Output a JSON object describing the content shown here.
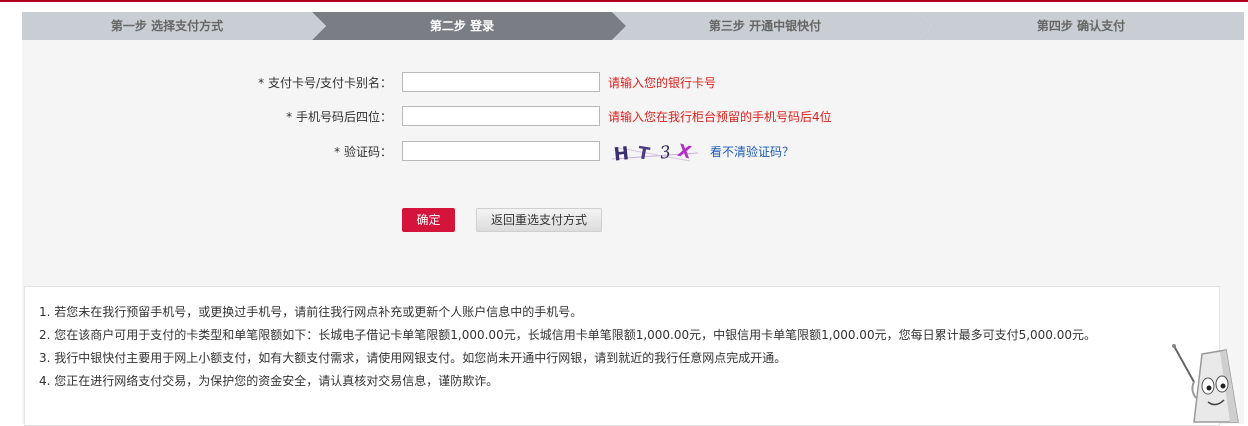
{
  "steps": [
    {
      "label": "第一步  选择支付方式",
      "active": false
    },
    {
      "label": "第二步  登录",
      "active": true
    },
    {
      "label": "第三步  开通中银快付",
      "active": false
    },
    {
      "label": "第四步  确认支付",
      "active": false
    }
  ],
  "form": {
    "card": {
      "label": "*  支付卡号/支付卡别名：",
      "value": "",
      "hint": "请输入您的银行卡号"
    },
    "phone": {
      "label": "*  手机号码后四位：",
      "value": "",
      "hint": "请输入您在我行柜台预留的手机号码后4位"
    },
    "captcha": {
      "label": "*  验证码：",
      "value": "",
      "image_text": "HT3X",
      "refresh_label": "看不清验证码？"
    }
  },
  "buttons": {
    "confirm": "确定",
    "back": "返回重选支付方式"
  },
  "notes": [
    "1. 若您未在我行预留手机号，或更换过手机号，请前往我行网点补充或更新个人账户信息中的手机号。",
    "2. 您在该商户可用于支付的卡类型和单笔限额如下：长城电子借记卡单笔限额1,000.00元，长城信用卡单笔限额1,000.00元，中银信用卡单笔限额1,000.00元，您每日累计最多可支付5,000.00元。",
    "3. 我行中银快付主要用于网上小额支付，如有大额支付需求，请使用网银支付。如您尚未开通中行网银，请到就近的我行任意网点完成开通。",
    "4. 您正在进行网络支付交易，为保护您的资金安全，请认真核对交易信息，谨防欺诈。"
  ],
  "colors": {
    "accent": "#d4143a",
    "hint": "#e0201c",
    "link": "#1d5bb5",
    "step_active": "#7a7e84",
    "step_inactive": "#c9ced4"
  }
}
